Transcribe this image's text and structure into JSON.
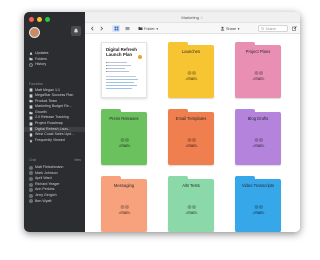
{
  "window": {
    "title": "Marketing",
    "controls": {
      "close_color": "#ff5f57",
      "min_color": "#febc2e",
      "max_color": "#28c840"
    }
  },
  "sidebar": {
    "top_items": [
      {
        "label": "Updates",
        "icon": "bell-icon"
      },
      {
        "label": "Folders",
        "icon": "folder-icon"
      },
      {
        "label": "History",
        "icon": "clock-icon"
      }
    ],
    "favorites_label": "Favorites",
    "favorites": [
      {
        "label": "Matt Megan 1:1"
      },
      {
        "label": "MegaStar Success Plan"
      },
      {
        "label": "Product Team"
      },
      {
        "label": "Marketing Budget Re..."
      },
      {
        "label": "Growth"
      },
      {
        "label": "2.0 Release Tracking"
      },
      {
        "label": "Project Roadmap"
      },
      {
        "label": "Digital Refresh Laun..."
      },
      {
        "label": "West Coast Sales Upd..."
      },
      {
        "label": "Frequently Viewed"
      }
    ],
    "chat_label": "Chat",
    "chat_new": "New",
    "chats": [
      {
        "label": "Matt Fleischmann"
      },
      {
        "label": "Mark Johnson"
      },
      {
        "label": "April Ward"
      },
      {
        "label": "Richard Yeager"
      },
      {
        "label": "Ann Perkins"
      },
      {
        "label": "Jerry Gergich"
      },
      {
        "label": "Ben Wyatt"
      }
    ]
  },
  "toolbar": {
    "folder_label": "Folder",
    "share_label": "Share",
    "search_placeholder": "Search"
  },
  "document": {
    "title": "Digital Refresh Launch Plan"
  },
  "folders": [
    {
      "label": "Launches",
      "color": "#f7c531"
    },
    {
      "label": "Project Plans",
      "color": "#ea8fb4"
    },
    {
      "label": "Press Releases",
      "color": "#6cc15f"
    },
    {
      "label": "Email Templates",
      "color": "#ef7f4f"
    },
    {
      "label": "Blog Drafts",
      "color": "#b484dd"
    },
    {
      "label": "Messaging",
      "color": "#f7a27c"
    },
    {
      "label": "A/B Tests",
      "color": "#8bd9a8"
    },
    {
      "label": "Video Transcripts",
      "color": "#36a7e8"
    }
  ]
}
